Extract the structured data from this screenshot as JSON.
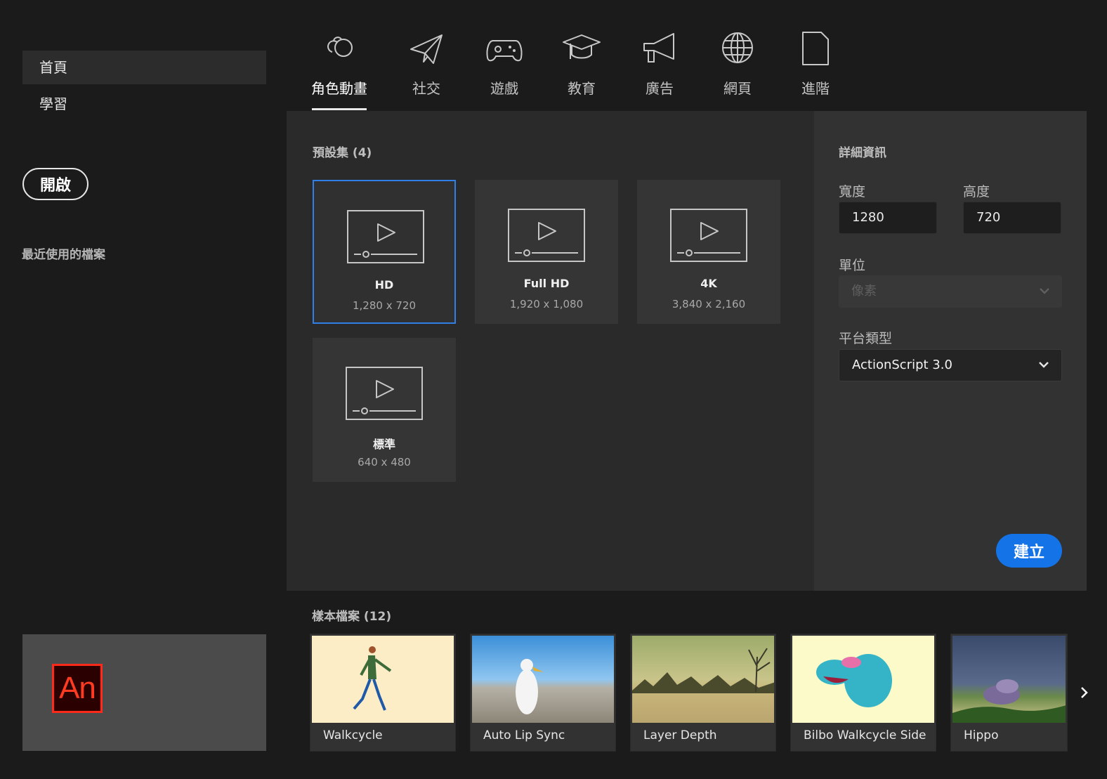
{
  "sidebar": {
    "items": [
      {
        "label": "首頁"
      },
      {
        "label": "學習"
      }
    ],
    "open_button": "開啟",
    "recent_title": "最近使用的檔案",
    "brand_logo": "An"
  },
  "tabs": [
    {
      "label": "角色動畫",
      "icon": "character-animation-icon"
    },
    {
      "label": "社交",
      "icon": "paper-plane-icon"
    },
    {
      "label": "遊戲",
      "icon": "gamepad-icon"
    },
    {
      "label": "教育",
      "icon": "graduation-cap-icon"
    },
    {
      "label": "廣告",
      "icon": "megaphone-icon"
    },
    {
      "label": "網頁",
      "icon": "globe-icon"
    },
    {
      "label": "進階",
      "icon": "document-icon"
    }
  ],
  "presets": {
    "title": "預設集 (4)",
    "items": [
      {
        "name": "HD",
        "size": "1,280 x 720"
      },
      {
        "name": "Full HD",
        "size": "1,920 x 1,080"
      },
      {
        "name": "4K",
        "size": "3,840 x 2,160"
      },
      {
        "name": "標準",
        "size": "640 x 480"
      }
    ]
  },
  "details": {
    "title": "詳細資訊",
    "width_label": "寬度",
    "width_value": "1280",
    "height_label": "高度",
    "height_value": "720",
    "unit_label": "單位",
    "unit_value": "像素",
    "platform_label": "平台類型",
    "platform_value": "ActionScript 3.0",
    "create_button": "建立"
  },
  "samples": {
    "title": "樣本檔案 (12)",
    "items": [
      {
        "name": "Walkcycle"
      },
      {
        "name": "Auto Lip Sync"
      },
      {
        "name": "Layer Depth"
      },
      {
        "name": "Bilbo Walkcycle Side"
      },
      {
        "name": "Hippo"
      }
    ]
  },
  "colors": {
    "accent": "#1473e6",
    "background": "#1b1b1b",
    "panel": "#2a2a2a"
  }
}
